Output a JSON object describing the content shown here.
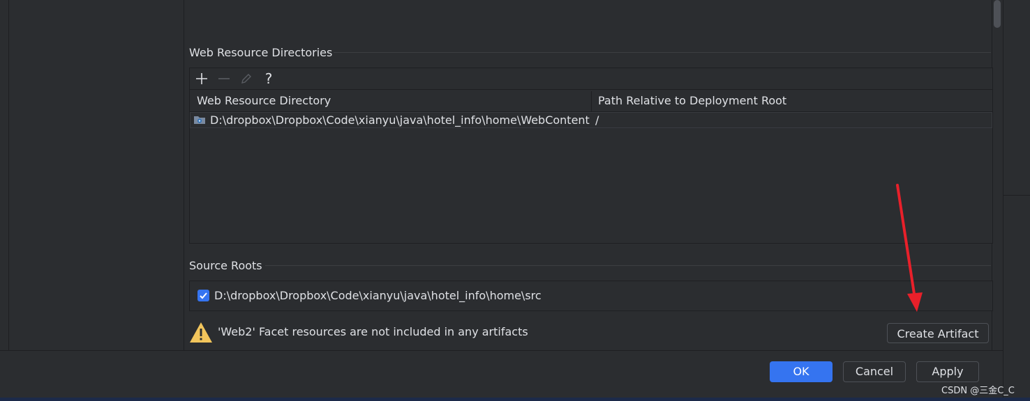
{
  "web_resource": {
    "section_title": "Web Resource Directories",
    "toolbar": {
      "add": "+",
      "remove": "−",
      "help": "?"
    },
    "columns": [
      "Web Resource Directory",
      "Path Relative to Deployment Root"
    ],
    "rows": [
      {
        "directory": "D:\\dropbox\\Dropbox\\Code\\xianyu\\java\\hotel_info\\home\\WebContent",
        "path": "/"
      }
    ]
  },
  "source_roots": {
    "section_title": "Source Roots",
    "items": [
      {
        "path": "D:\\dropbox\\Dropbox\\Code\\xianyu\\java\\hotel_info\\home\\src",
        "checked": true
      }
    ]
  },
  "warning": {
    "text": "'Web2' Facet resources are not included in any artifacts",
    "action_label": "Create Artifact"
  },
  "dialog_buttons": {
    "ok": "OK",
    "cancel": "Cancel",
    "apply": "Apply"
  },
  "watermark": "CSDN @三金C_C",
  "colors": {
    "accent": "#3574f0",
    "background": "#2b2d30",
    "warning": "#f2c55c",
    "arrow": "#e8202a"
  },
  "icons": [
    "plus-icon",
    "minus-icon",
    "edit-icon",
    "help-icon",
    "folder-icon",
    "checkmark-icon",
    "warning-icon"
  ]
}
